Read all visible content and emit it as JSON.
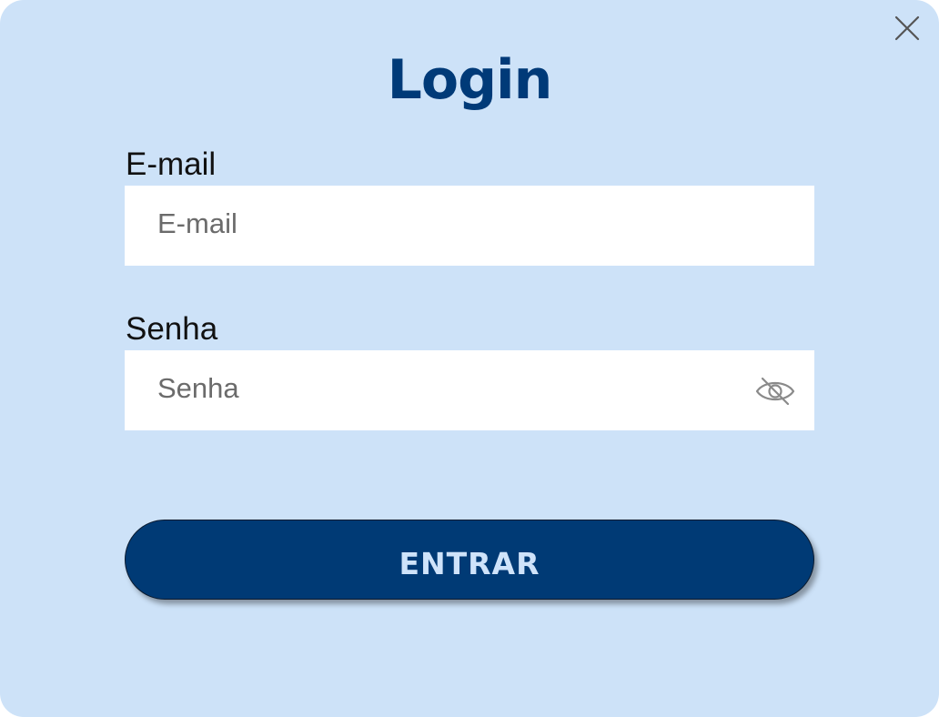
{
  "modal": {
    "title": "Login",
    "background_color": "#cde2f8",
    "close_icon": "close-icon"
  },
  "form": {
    "email": {
      "label": "E-mail",
      "value": "",
      "placeholder": "E-mail"
    },
    "password": {
      "label": "Senha",
      "value": "",
      "placeholder": "Senha",
      "toggle_icon": "eye-off-icon"
    },
    "submit_label": "ENTRAR"
  },
  "colors": {
    "title": "#003a78",
    "button_bg": "#003a75",
    "button_text": "#cfe3fa",
    "input_bg": "#ffffff"
  }
}
